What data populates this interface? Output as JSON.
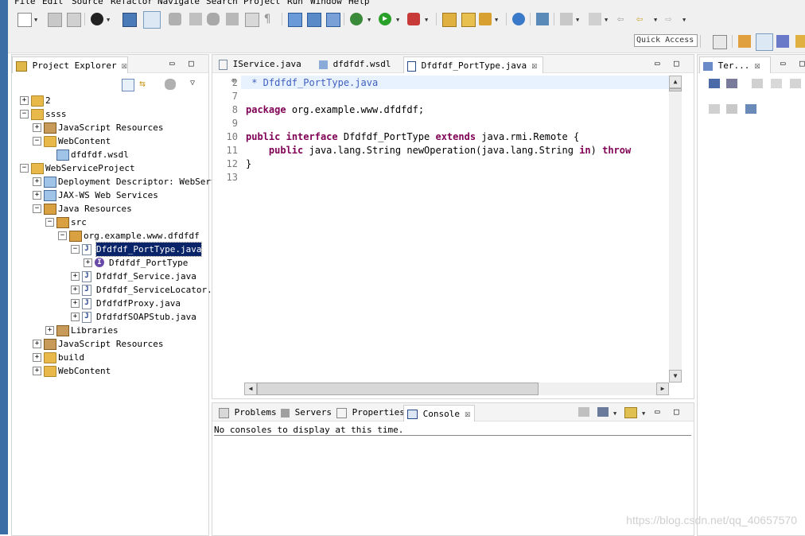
{
  "menu": [
    "File",
    "Edit",
    "Source",
    "Refactor",
    "Navigate",
    "Search",
    "Project",
    "Run",
    "Window",
    "Help"
  ],
  "toolbar": {
    "quick_access": "Quick Access"
  },
  "project_explorer": {
    "title": "Project Explorer",
    "tree": [
      {
        "label": "2",
        "level": 0,
        "expander": "+",
        "icon": "project-icon"
      },
      {
        "label": "ssss",
        "level": 0,
        "expander": "-",
        "icon": "web-project-icon"
      },
      {
        "label": "JavaScript Resources",
        "level": 1,
        "expander": "+",
        "icon": "js-resources-icon"
      },
      {
        "label": "WebContent",
        "level": 1,
        "expander": "-",
        "icon": "folder-icon"
      },
      {
        "label": "dfdfdf.wsdl",
        "level": 2,
        "expander": "",
        "icon": "wsdl-file-icon"
      },
      {
        "label": "WebServiceProject",
        "level": 0,
        "expander": "-",
        "icon": "web-project-icon"
      },
      {
        "label": "Deployment Descriptor: WebServi",
        "level": 1,
        "expander": "+",
        "icon": "deployment-descriptor-icon"
      },
      {
        "label": "JAX-WS Web Services",
        "level": 1,
        "expander": "+",
        "icon": "jaxws-icon"
      },
      {
        "label": "Java Resources",
        "level": 1,
        "expander": "-",
        "icon": "java-resources-icon"
      },
      {
        "label": "src",
        "level": 2,
        "expander": "-",
        "icon": "source-folder-icon"
      },
      {
        "label": "org.example.www.dfdfdf",
        "level": 3,
        "expander": "-",
        "icon": "package-icon"
      },
      {
        "label": "Dfdfdf_PortType.java",
        "level": 4,
        "expander": "-",
        "icon": "java-file-icon",
        "selected": true
      },
      {
        "label": "Dfdfdf_PortType",
        "level": 5,
        "expander": "+",
        "icon": "interface-icon"
      },
      {
        "label": "Dfdfdf_Service.java",
        "level": 4,
        "expander": "+",
        "icon": "java-file-icon"
      },
      {
        "label": "Dfdfdf_ServiceLocator.j",
        "level": 4,
        "expander": "+",
        "icon": "java-file-icon"
      },
      {
        "label": "DfdfdfProxy.java",
        "level": 4,
        "expander": "+",
        "icon": "java-file-icon"
      },
      {
        "label": "DfdfdfSOAPStub.java",
        "level": 4,
        "expander": "+",
        "icon": "java-file-icon"
      },
      {
        "label": "Libraries",
        "level": 2,
        "expander": "+",
        "icon": "libraries-icon"
      },
      {
        "label": "JavaScript Resources",
        "level": 1,
        "expander": "+",
        "icon": "js-resources-icon"
      },
      {
        "label": "build",
        "level": 1,
        "expander": "+",
        "icon": "folder-icon"
      },
      {
        "label": "WebContent",
        "level": 1,
        "expander": "+",
        "icon": "folder-icon"
      }
    ]
  },
  "editor": {
    "tabs": [
      {
        "label": "IService.java",
        "active": false
      },
      {
        "label": "dfdfdf.wsdl",
        "active": false
      },
      {
        "label": "Dfdfdf_PortType.java",
        "active": true
      }
    ],
    "lines": [
      {
        "num": "2",
        "text": " * Dfdfdf_PortType.java"
      },
      {
        "num": "7",
        "text": ""
      },
      {
        "num": "8",
        "text": "package org.example.www.dfdfdf;"
      },
      {
        "num": "9",
        "text": ""
      },
      {
        "num": "10",
        "text": "public interface Dfdfdf_PortType extends java.rmi.Remote {"
      },
      {
        "num": "11",
        "text": "    public java.lang.String newOperation(java.lang.String in) throw"
      },
      {
        "num": "12",
        "text": "}"
      },
      {
        "num": "13",
        "text": ""
      }
    ]
  },
  "bottom_panel": {
    "tabs": [
      {
        "label": "Problems",
        "active": false
      },
      {
        "label": "Servers",
        "active": false
      },
      {
        "label": "Properties",
        "active": false
      },
      {
        "label": "Console",
        "active": true
      }
    ],
    "console_message": "No consoles to display at this time."
  },
  "right_panel": {
    "tab_label": "Ter..."
  },
  "watermark": "https://blog.csdn.net/qq_40657570"
}
